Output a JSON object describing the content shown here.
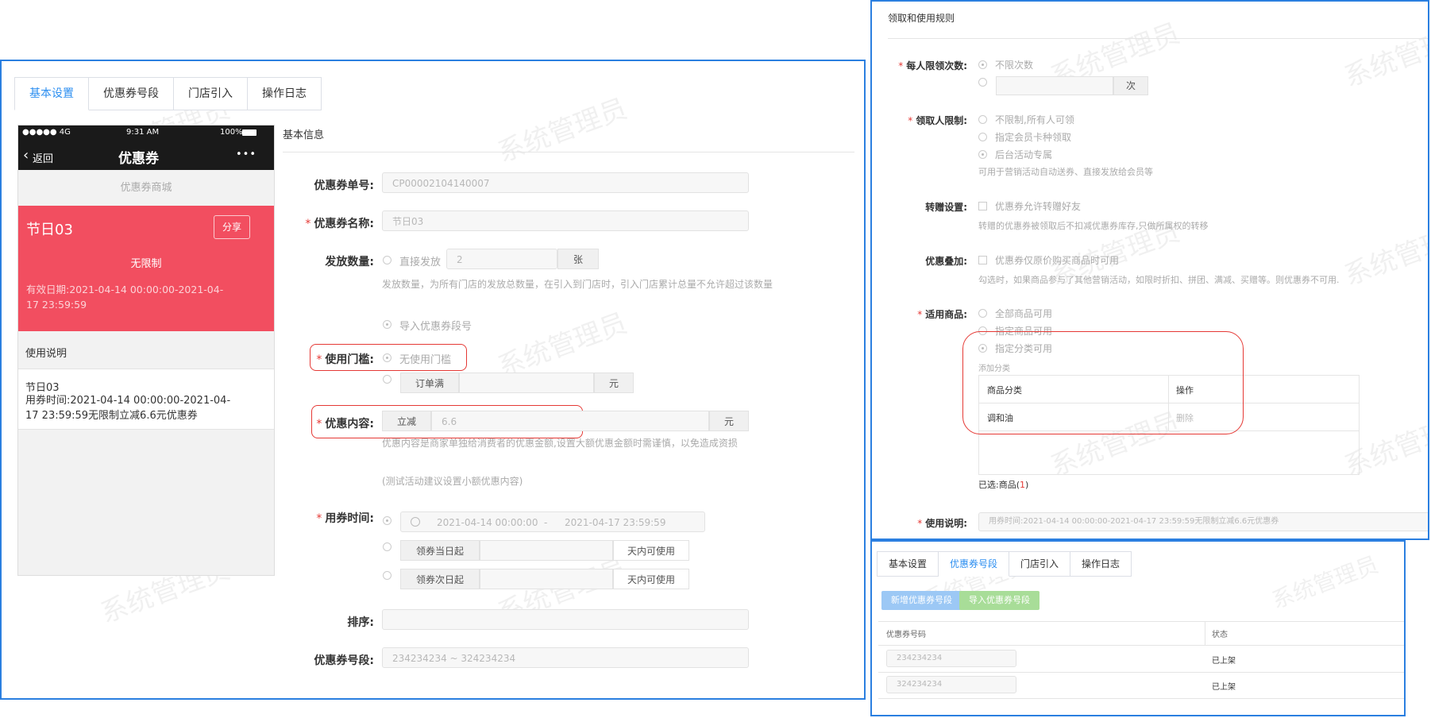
{
  "watermark": "系统管理员",
  "main": {
    "tabs": [
      {
        "label": "基本设置",
        "active": true
      },
      {
        "label": "优惠券号段",
        "active": false
      },
      {
        "label": "门店引入",
        "active": false
      },
      {
        "label": "操作日志",
        "active": false
      }
    ],
    "phone": {
      "signal": "●●●●● 4G",
      "time": "9:31 AM",
      "battery": "100%",
      "back": "返回",
      "title": "优惠券",
      "more": "•••",
      "mall": "优惠券商城",
      "coupon_name": "节日03",
      "share": "分享",
      "limit": "无限制",
      "validity": "有效日期:2021-04-14 00:00:00-2021-04-17 23:59:59",
      "usage_title": "使用说明",
      "usage_name": "节日03",
      "usage_text": "用券时间:2021-04-14 00:00:00-2021-04-17 23:59:59无限制立减6.6元优惠券"
    },
    "section_title": "基本信息",
    "form": {
      "coupon_no_label": "优惠券单号:",
      "coupon_no": "CP00002104140007",
      "coupon_name_label": "优惠券名称:",
      "coupon_name": "节日03",
      "issue_label": "发放数量:",
      "direct_issue": "直接发放",
      "issue_qty": "2",
      "issue_unit": "张",
      "issue_hint": "发放数量，为所有门店的发放总数量，在引入到门店时，引入门店累计总量不允许超过该数量",
      "import_segment": "导入优惠券段号",
      "threshold_label": "使用门槛:",
      "no_threshold": "无使用门槛",
      "order_full": "订单满",
      "yuan": "元",
      "content_label": "优惠内容:",
      "reduce": "立减",
      "reduce_value": "6.6",
      "content_hint": "优惠内容是商家单独给消费者的优惠金额,设置大额优惠金额时需谨慎，以免造成资损",
      "content_hint2": "(测试活动建议设置小额优惠内容)",
      "time_label": "用券时间:",
      "start_time": "2021-04-14 00:00:00",
      "dash": "-",
      "end_time": "2021-04-17 23:59:59",
      "from_claim_day": "领券当日起",
      "from_next_day": "领券次日起",
      "days_valid": "天内可使用",
      "sort_label": "排序:",
      "segment_label": "优惠券号段:",
      "segment_value": "234234234 ~ 324234234"
    }
  },
  "rules": {
    "section_title": "领取和使用规则",
    "per_person_label": "每人限领次数:",
    "unlimited_times": "不限次数",
    "times_unit": "次",
    "receiver_label": "领取人限制:",
    "receiver_opts": [
      "不限制,所有人可领",
      "指定会员卡种领取",
      "后台活动专属"
    ],
    "receiver_hint": "可用于营销活动自动送券、直接发放给会员等",
    "gift_label": "转赠设置:",
    "gift_opt": "优惠券允许转赠好友",
    "gift_hint": "转赠的优惠券被领取后不扣减优惠券库存,只做所属权的转移",
    "stack_label": "优惠叠加:",
    "stack_opt": "优惠券仅原价购买商品时可用",
    "stack_hint": "勾选时，如果商品参与了其他营销活动，如限时折扣、拼团、满减、买赠等。则优惠券不可用.",
    "goods_label": "适用商品:",
    "goods_opts": [
      "全部商品可用",
      "指定商品可用",
      "指定分类可用"
    ],
    "add_category": "添加分类",
    "table_headers": [
      "商品分类",
      "操作"
    ],
    "table_rows": [
      {
        "category": "调和油",
        "action": "删除"
      }
    ],
    "selected_prefix": "已选:商品(",
    "selected_count": "1",
    "selected_suffix": ")",
    "usage_label": "使用说明:",
    "usage_value": "用券时间:2021-04-14 00:00:00-2021-04-17 23:59:59无限制立减6.6元优惠券"
  },
  "segment": {
    "tabs": [
      {
        "label": "基本设置",
        "active": false
      },
      {
        "label": "优惠券号段",
        "active": true
      },
      {
        "label": "门店引入",
        "active": false
      },
      {
        "label": "操作日志",
        "active": false
      }
    ],
    "add_button": "新增优惠券号段",
    "import_button": "导入优惠券号段",
    "headers": [
      "优惠券号码",
      "状态"
    ],
    "rows": [
      {
        "code": "234234234",
        "status": "已上架"
      },
      {
        "code": "324234234",
        "status": "已上架"
      }
    ]
  },
  "colors": {
    "accent": "#2b8ef0",
    "coupon_red": "#f24e60",
    "required": "#e53935",
    "border_blue": "#2b7fe0"
  }
}
